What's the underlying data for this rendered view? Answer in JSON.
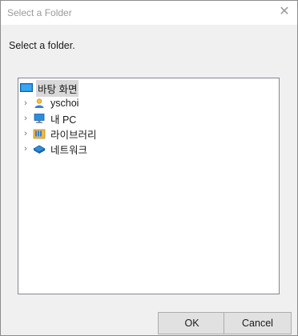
{
  "window": {
    "title": "Select a Folder",
    "close_icon": "close-icon"
  },
  "description": "Select a folder.",
  "tree": {
    "root": {
      "label": "바탕 화면",
      "icon": "desktop-icon",
      "selected": true
    },
    "children": [
      {
        "label": "yschoi",
        "icon": "user-folder-icon",
        "expandable": true
      },
      {
        "label": "내 PC",
        "icon": "this-pc-icon",
        "expandable": true
      },
      {
        "label": "라이브러리",
        "icon": "libraries-icon",
        "expandable": true
      },
      {
        "label": "네트워크",
        "icon": "network-icon",
        "expandable": true
      }
    ]
  },
  "buttons": {
    "ok": "OK",
    "cancel": "Cancel"
  },
  "colors": {
    "dialog_bg": "#f0f0f0",
    "selection": "#d9d9d9",
    "desktop_blue": "#1a86d8"
  }
}
